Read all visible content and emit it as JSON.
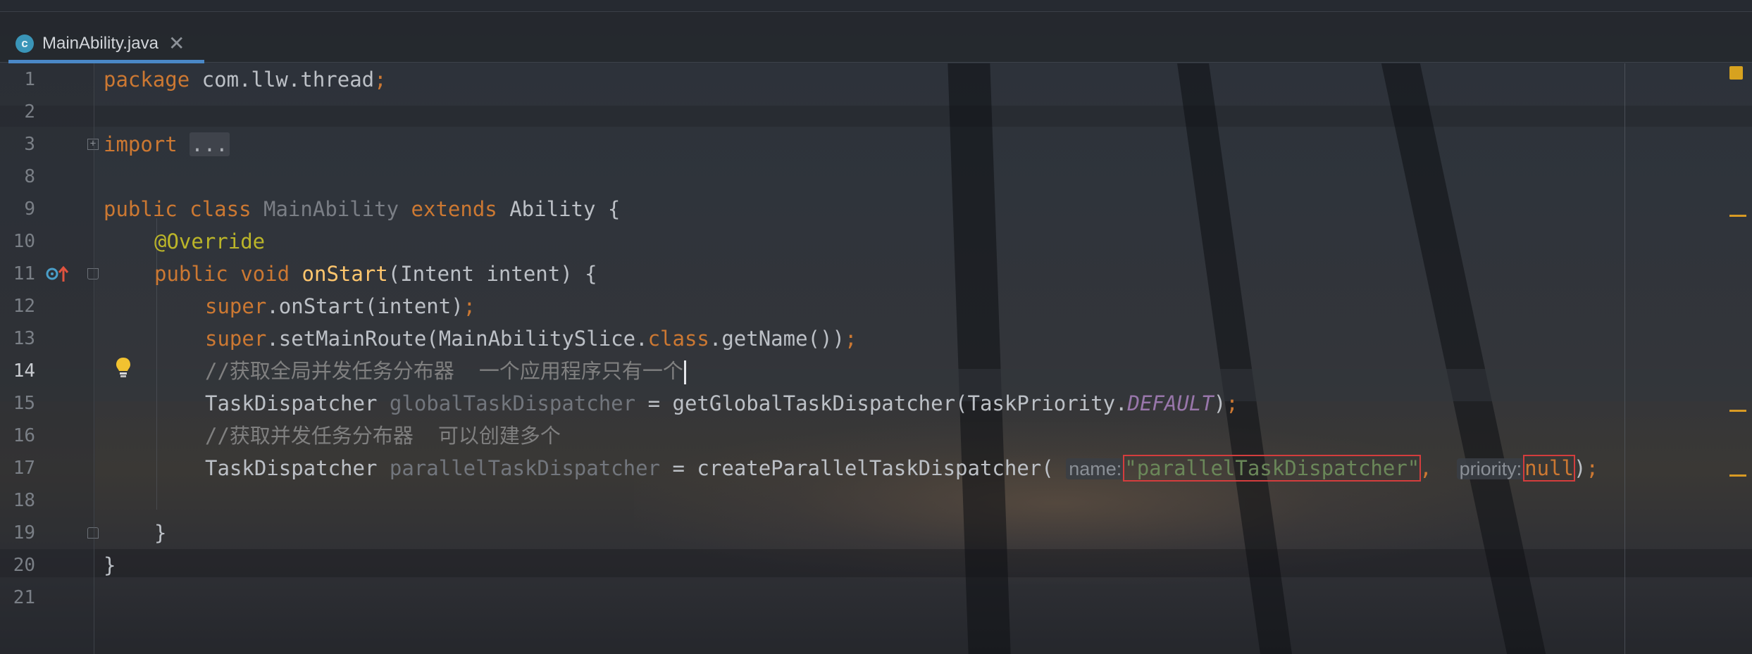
{
  "tab": {
    "icon_letter": "c",
    "filename": "MainAbility.java",
    "close_glyph": "✕"
  },
  "line_numbers": [
    "1",
    "2",
    "3",
    "8",
    "9",
    "10",
    "11",
    "12",
    "13",
    "14",
    "15",
    "16",
    "17",
    "18",
    "19",
    "20",
    "21"
  ],
  "current_line": "14",
  "code": {
    "l1": {
      "kw": "package",
      "rest": " com.llw.thread",
      "semi": ";"
    },
    "l3": {
      "kw": "import",
      "space": " ",
      "folded": "..."
    },
    "l9": {
      "kw1": "public",
      "kw2": "class",
      "cls": "MainAbility",
      "kw3": "extends",
      "rest": " Ability {"
    },
    "l10": {
      "ann": "@Override"
    },
    "l11": {
      "kw1": "public",
      "kw2": "void",
      "fn": "onStart",
      "rest": "(Intent intent) {"
    },
    "l12": {
      "kw": "super",
      "rest": ".onStart(intent)",
      "semi": ";"
    },
    "l13": {
      "kw": "super",
      "rest1": ".setMainRoute(MainAbilitySlice.",
      "kw2": "class",
      "rest2": ".getName())",
      "semi": ";"
    },
    "l14": {
      "cmt": "//获取全局并发任务分布器  一个应用程序只有一个"
    },
    "l15": {
      "type": "TaskDispatcher",
      "var": "globalTaskDispatcher",
      "rest1": " = getGlobalTaskDispatcher(TaskPriority.",
      "const": "DEFAULT",
      "rest2": ")",
      "semi": ";"
    },
    "l16": {
      "cmt": "//获取并发任务分布器  可以创建多个"
    },
    "l17": {
      "type": "TaskDispatcher",
      "var": "parallelTaskDispatcher",
      "rest1": " = createParallelTaskDispatcher(",
      "hint1": "name:",
      "str": "\"parallelTaskDispatcher\"",
      "comma": ",",
      "hint2": "priority:",
      "null": "null",
      "rest2": ")",
      "semi": ";"
    },
    "l19": {
      "text": "}"
    },
    "l20": {
      "text": "}"
    }
  },
  "colors": {
    "keyword": "#cc7832",
    "annotation": "#bbb529",
    "method": "#ffc66d",
    "comment": "#808080",
    "string": "#6a8759",
    "constant": "#9876aa",
    "highlight_box": "#d43d3d",
    "tab_underline": "#4a88c7"
  }
}
